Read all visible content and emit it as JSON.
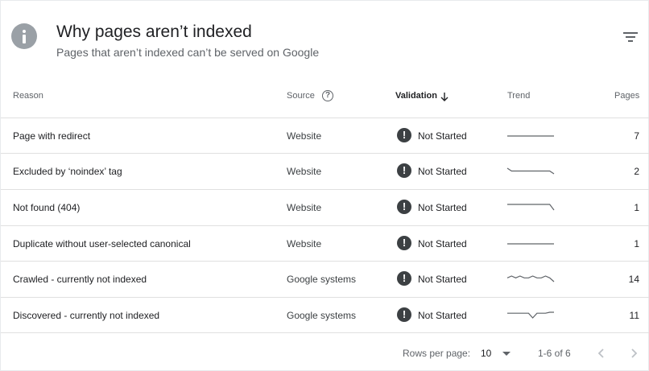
{
  "header": {
    "icon": "info-icon",
    "title": "Why pages aren’t indexed",
    "subtitle": "Pages that aren’t indexed can’t be served on Google",
    "filter_icon": "filter-icon"
  },
  "table": {
    "columns": {
      "reason": "Reason",
      "source": "Source",
      "validation": "Validation",
      "trend": "Trend",
      "pages": "Pages"
    },
    "rows": [
      {
        "reason": "Page with redirect",
        "source": "Website",
        "validation": "Not Started",
        "pages": "7",
        "trend": [
          1,
          1,
          1,
          1,
          1,
          1,
          1,
          1,
          1,
          1,
          1,
          1
        ]
      },
      {
        "reason": "Excluded by ‘noindex’ tag",
        "source": "Website",
        "validation": "Not Started",
        "pages": "2",
        "trend": [
          2,
          1,
          1,
          1,
          1,
          1,
          1,
          1,
          1,
          1,
          1,
          0
        ]
      },
      {
        "reason": "Not found (404)",
        "source": "Website",
        "validation": "Not Started",
        "pages": "1",
        "trend": [
          1,
          1,
          1,
          1,
          1,
          1,
          1,
          1,
          1,
          1,
          1,
          0
        ]
      },
      {
        "reason": "Duplicate without user-selected canonical",
        "source": "Website",
        "validation": "Not Started",
        "pages": "1",
        "trend": [
          1,
          1,
          1,
          1,
          1,
          1,
          1,
          1,
          1,
          1,
          1,
          1
        ]
      },
      {
        "reason": "Crawled - currently not indexed",
        "source": "Google systems",
        "validation": "Not Started",
        "pages": "14",
        "trend": [
          14,
          15,
          14,
          15,
          14,
          14,
          15,
          14,
          14,
          15,
          14,
          12
        ]
      },
      {
        "reason": "Discovered - currently not indexed",
        "source": "Google systems",
        "validation": "Not Started",
        "pages": "11",
        "trend": [
          11,
          11,
          11,
          11,
          11,
          11,
          6,
          11,
          11,
          11,
          12,
          12
        ]
      }
    ]
  },
  "footer": {
    "rows_per_page_label": "Rows per page:",
    "rows_per_page_value": "10",
    "range": "1-6 of 6"
  },
  "colors": {
    "status_icon": "#3c4043",
    "trend_line": "#5f6368",
    "divider": "#e0e0e0"
  }
}
